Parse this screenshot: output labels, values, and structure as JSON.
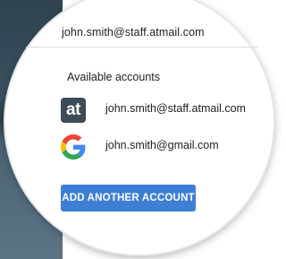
{
  "account_menu": {
    "current_email": "john.smith@staff.atmail.com",
    "heading": "Available accounts",
    "accounts": [
      {
        "email": "john.smith@staff.atmail.com",
        "icon": "atmail-logo-icon",
        "icon_text": "at"
      },
      {
        "email": "john.smith@gmail.com",
        "icon": "google-logo-icon"
      }
    ],
    "add_button_label": "ADD ANOTHER ACCOUNT"
  },
  "colors": {
    "button": "#3d7fd6",
    "atmail_icon_bg": "#3d4a57",
    "background_strip": "#3a5160"
  }
}
